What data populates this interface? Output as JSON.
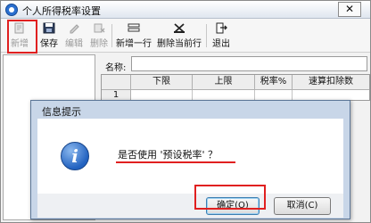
{
  "window": {
    "title": "个人所得税率设置",
    "close_glyph": "✕"
  },
  "toolbar": {
    "buttons": [
      {
        "id": "new",
        "label": "新增",
        "icon": "new-document-icon",
        "enabled": false
      },
      {
        "id": "save",
        "label": "保存",
        "icon": "floppy-save-icon",
        "enabled": true
      },
      {
        "id": "edit",
        "label": "编辑",
        "icon": "pencil-edit-icon",
        "enabled": false
      },
      {
        "id": "delete",
        "label": "删除",
        "icon": "delete-icon",
        "enabled": false
      },
      {
        "id": "add_row",
        "label": "新增一行",
        "icon": "insert-row-icon",
        "enabled": true
      },
      {
        "id": "delete_row",
        "label": "删除当前行",
        "icon": "delete-row-icon",
        "enabled": true
      },
      {
        "id": "exit",
        "label": "退出",
        "icon": "exit-door-icon",
        "enabled": true
      }
    ]
  },
  "form": {
    "name_label": "名称:",
    "name_value": "",
    "grid": {
      "columns": [
        "",
        "下限",
        "上限",
        "税率%",
        "速算扣除数"
      ],
      "rows": [
        {
          "row_number": "1",
          "cells": [
            "",
            "",
            "",
            ""
          ]
        }
      ]
    }
  },
  "dialog": {
    "title": "信息提示",
    "icon": "info-icon",
    "icon_glyph": "i",
    "message": "是否使用 '预设税率' ？",
    "ok_label": "确定(O)",
    "cancel_label": "取消(C)"
  },
  "colors": {
    "highlight_red": "#e02020",
    "dialog_frame": "#c8d6e8",
    "info_blue": "#2262c0"
  }
}
